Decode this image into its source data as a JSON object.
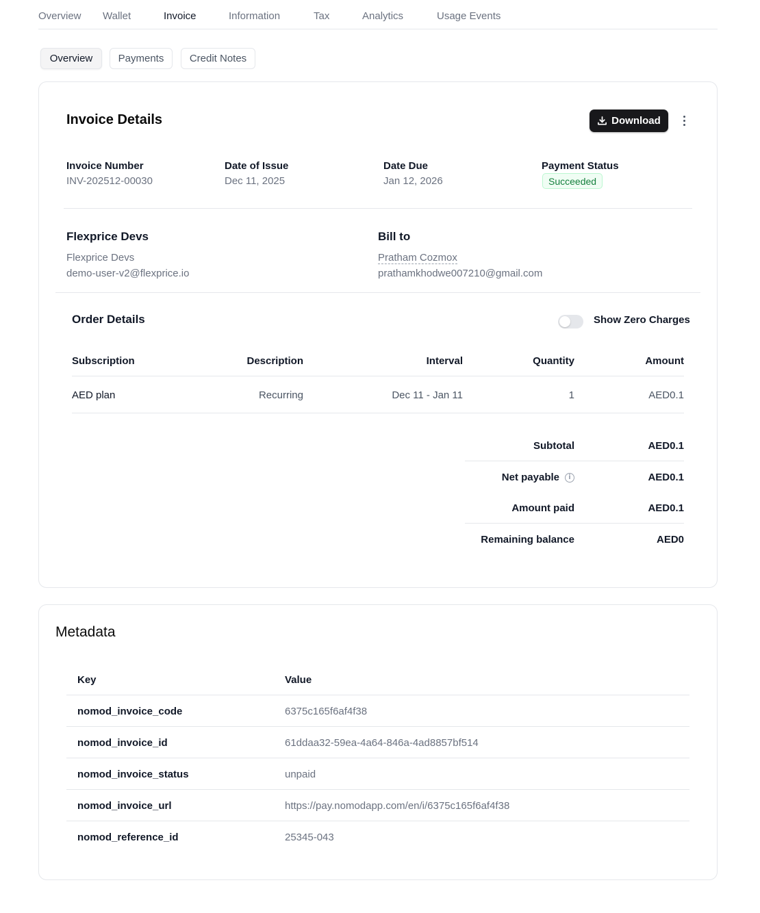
{
  "top_tabs": [
    {
      "label": "Overview"
    },
    {
      "label": "Wallet"
    },
    {
      "label": "Invoice"
    },
    {
      "label": "Information"
    },
    {
      "label": "Tax"
    },
    {
      "label": "Analytics"
    },
    {
      "label": "Usage Events"
    }
  ],
  "active_top_tab": "Invoice",
  "sub_tabs": [
    {
      "label": "Overview"
    },
    {
      "label": "Payments"
    },
    {
      "label": "Credit Notes"
    }
  ],
  "active_sub_tab": "Overview",
  "invoice": {
    "title": "Invoice Details",
    "download_label": "Download",
    "fields": {
      "invoice_number": {
        "label": "Invoice Number",
        "value": "INV-202512-00030"
      },
      "date_of_issue": {
        "label": "Date of Issue",
        "value": "Dec 11, 2025"
      },
      "date_due": {
        "label": "Date Due",
        "value": "Jan 12, 2026"
      },
      "payment_status": {
        "label": "Payment Status",
        "value": "Succeeded"
      }
    },
    "from": {
      "name": "Flexprice Devs",
      "line1": "Flexprice Devs",
      "email": "demo-user-v2@flexprice.io"
    },
    "bill_to": {
      "title": "Bill to",
      "name": "Pratham Cozmox",
      "email": "prathamkhodwe007210@gmail.com"
    },
    "order": {
      "title": "Order Details",
      "toggle_label": "Show Zero Charges",
      "show_zero_charges": false,
      "columns": {
        "subscription": "Subscription",
        "description": "Description",
        "interval": "Interval",
        "quantity": "Quantity",
        "amount": "Amount"
      },
      "rows": [
        {
          "subscription": "AED plan",
          "description": "Recurring",
          "interval": "Dec 11 - Jan 11",
          "quantity": "1",
          "amount": "AED0.1"
        }
      ]
    },
    "summary": {
      "subtotal": {
        "label": "Subtotal",
        "value": "AED0.1"
      },
      "net_payable": {
        "label": "Net payable",
        "value": "AED0.1"
      },
      "amount_paid": {
        "label": "Amount paid",
        "value": "AED0.1"
      },
      "remaining_balance": {
        "label": "Remaining balance",
        "value": "AED0"
      }
    }
  },
  "metadata": {
    "title": "Metadata",
    "columns": {
      "key": "Key",
      "value": "Value"
    },
    "rows": [
      {
        "key": "nomod_invoice_code",
        "value": "6375c165f6af4f38"
      },
      {
        "key": "nomod_invoice_id",
        "value": "61ddaa32-59ea-4a64-846a-4ad8857bf514"
      },
      {
        "key": "nomod_invoice_status",
        "value": "unpaid"
      },
      {
        "key": "nomod_invoice_url",
        "value": "https://pay.nomodapp.com/en/i/6375c165f6af4f38"
      },
      {
        "key": "nomod_reference_id",
        "value": "25345-043"
      }
    ]
  },
  "icons": {
    "download": "download-icon",
    "more": "more-vertical-icon",
    "info": "info-icon"
  }
}
